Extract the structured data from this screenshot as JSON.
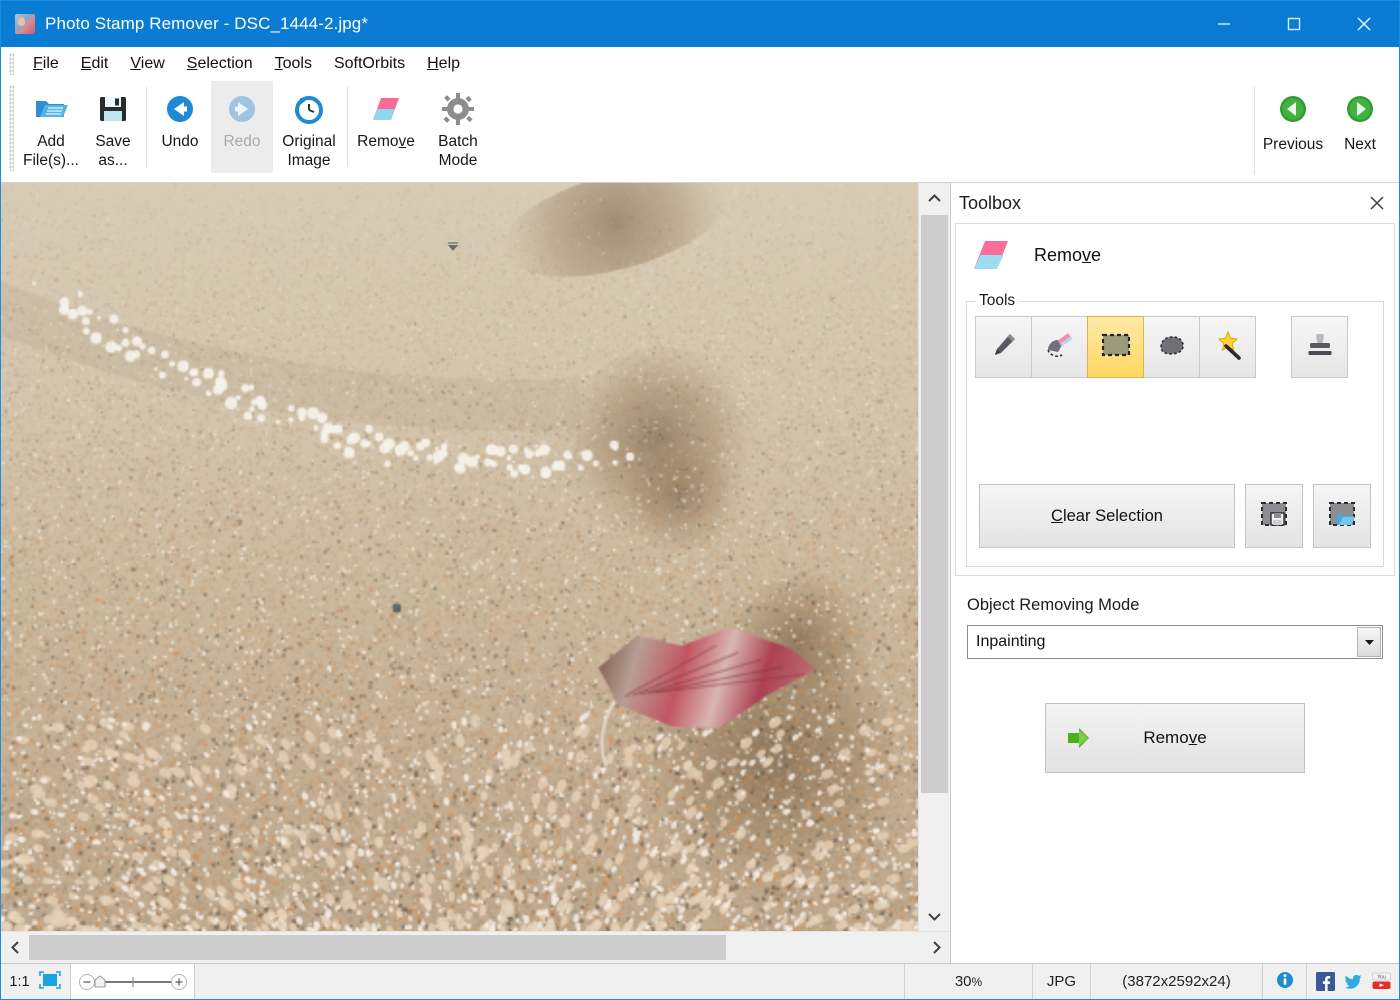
{
  "window": {
    "title": "Photo Stamp Remover - DSC_1444-2.jpg*",
    "app_icon": "app-photo-icon",
    "minimize": "minimize-icon",
    "maximize": "maximize-icon",
    "close": "close-icon",
    "titlebar_color": "#0a7cd4"
  },
  "menubar": {
    "items": [
      {
        "label": "File",
        "accel": "F"
      },
      {
        "label": "Edit",
        "accel": "E"
      },
      {
        "label": "View",
        "accel": "V"
      },
      {
        "label": "Selection",
        "accel": "S"
      },
      {
        "label": "Tools",
        "accel": "T"
      },
      {
        "label": "SoftOrbits",
        "accel": ""
      },
      {
        "label": "Help",
        "accel": "H"
      }
    ]
  },
  "toolbar": {
    "add_files": "Add\nFile(s)...",
    "save_as": "Save\nas...",
    "undo": "Undo",
    "redo": "Redo",
    "original_image": "Original\nImage",
    "remove": "Remove",
    "batch_mode": "Batch\nMode",
    "previous": "Previous",
    "next": "Next",
    "overflow": "toolbar-overflow-chevron"
  },
  "toolbox": {
    "title": "Toolbox",
    "close": "close-icon",
    "mode_title": "Remove",
    "tools_group_label": "Tools",
    "tools": [
      {
        "name": "pencil-tool",
        "icon": "pencil-icon",
        "active": false
      },
      {
        "name": "eraser-tool",
        "icon": "eraser-icon",
        "active": false
      },
      {
        "name": "rectangle-tool",
        "icon": "rectangle-select-icon",
        "active": true
      },
      {
        "name": "lasso-tool",
        "icon": "lasso-icon",
        "active": false
      },
      {
        "name": "magic-wand-tool",
        "icon": "magic-wand-icon",
        "active": false
      },
      {
        "name": "stamp-tool",
        "icon": "stamp-icon",
        "active": false
      }
    ],
    "clear_selection": "Clear Selection",
    "save_selection": "save-selection-icon",
    "load_selection": "load-selection-icon",
    "object_removing_mode_label": "Object Removing Mode",
    "object_removing_mode_value": "Inpainting",
    "remove_button": "Remove",
    "highlight_color": "#ffd760"
  },
  "canvas": {
    "scroll_up": "chevron-up-icon",
    "scroll_down": "chevron-down-icon",
    "scroll_left": "chevron-left-icon",
    "scroll_right": "chevron-right-icon",
    "image_description": "beach sand with footprints and a red leaf"
  },
  "statusbar": {
    "zoom_ratio": "1:1",
    "fit_icon": "fit-to-window-icon",
    "zoom_out": "zoom-out-icon",
    "zoom_in": "zoom-in-icon",
    "zoom_percent": "30",
    "zoom_percent_suffix": "%",
    "file_format": "JPG",
    "dimensions": "(3872x2592x24)",
    "info": "info-icon",
    "facebook": "facebook-icon",
    "twitter": "twitter-icon",
    "youtube": "youtube-icon"
  }
}
